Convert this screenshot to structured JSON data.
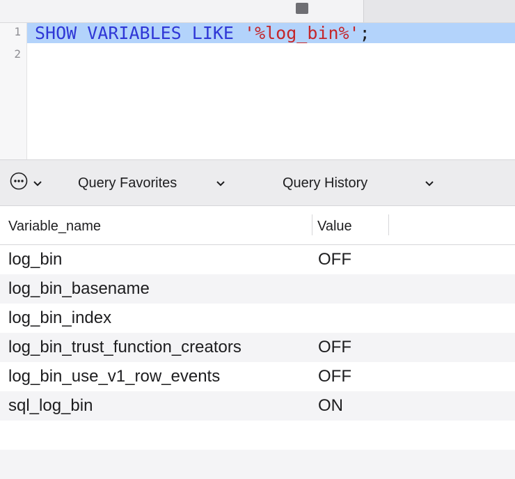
{
  "editor": {
    "lines": [
      {
        "number": "1",
        "keywords": "SHOW VARIABLES LIKE ",
        "string": "'%log_bin%'",
        "terminator": ";"
      },
      {
        "number": "2"
      }
    ]
  },
  "toolbar": {
    "favorites_label": "Query Favorites",
    "history_label": "Query History"
  },
  "results": {
    "columns": [
      "Variable_name",
      "Value"
    ],
    "rows": [
      {
        "name": "log_bin",
        "value": "OFF"
      },
      {
        "name": "log_bin_basename",
        "value": ""
      },
      {
        "name": "log_bin_index",
        "value": ""
      },
      {
        "name": "log_bin_trust_function_creators",
        "value": "OFF"
      },
      {
        "name": "log_bin_use_v1_row_events",
        "value": "OFF"
      },
      {
        "name": "sql_log_bin",
        "value": "ON"
      }
    ]
  },
  "colors": {
    "keyword": "#2f37d6",
    "string": "#c4262a",
    "selection": "#b3d3fb"
  },
  "icons": [
    "lock-icon",
    "more-options-icon",
    "chevron-down-icon"
  ]
}
